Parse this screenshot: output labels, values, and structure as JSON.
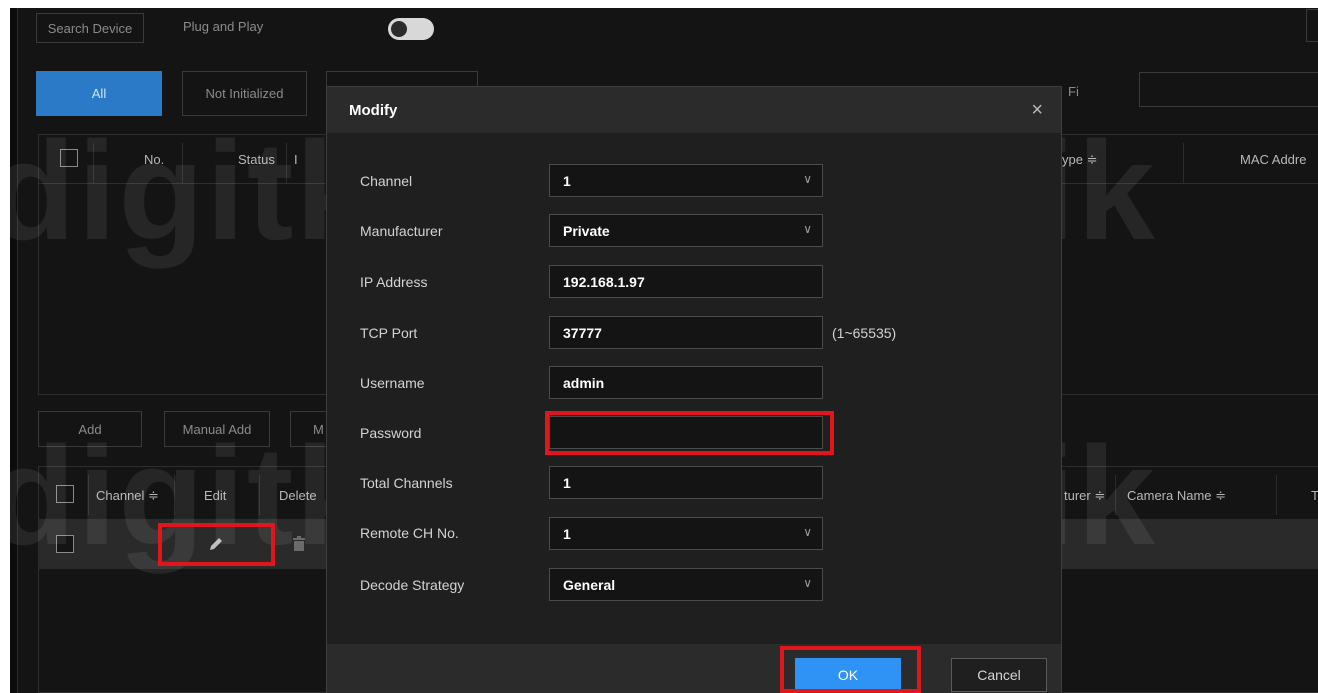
{
  "toolbar": {
    "search_device": "Search Device",
    "plug_and_play": "Plug and Play"
  },
  "filter_tabs": {
    "all": "All",
    "not_initialized": "Not Initialized",
    "filter_partial": "Fi"
  },
  "search_table": {
    "headers": {
      "no": "No.",
      "status": "Status",
      "ip_partial": "I",
      "type_partial": "ype ≑",
      "mac_partial": "MAC Addre"
    }
  },
  "actions": {
    "add": "Add",
    "manual_add": "Manual Add",
    "more_partial": "M"
  },
  "added_table": {
    "headers": {
      "channel": "Channel ≑",
      "edit": "Edit",
      "delete": "Delete",
      "manufacturer_partial": "turer ≑",
      "camera_name": "Camera Name ≑",
      "t_partial": "T"
    }
  },
  "watermark": "digitklik",
  "dialog": {
    "title": "Modify",
    "close_icon": "×",
    "fields": {
      "channel": {
        "label": "Channel",
        "value": "1"
      },
      "manufacturer": {
        "label": "Manufacturer",
        "value": "Private"
      },
      "ip_address": {
        "label": "IP Address",
        "value": "192.168.1.97"
      },
      "tcp_port": {
        "label": "TCP Port",
        "value": "37777",
        "hint": "(1~65535)"
      },
      "username": {
        "label": "Username",
        "value": "admin"
      },
      "password": {
        "label": "Password",
        "value": ""
      },
      "total_channels": {
        "label": "Total Channels",
        "value": "1"
      },
      "remote_ch_no": {
        "label": "Remote CH No.",
        "value": "1"
      },
      "decode_strategy": {
        "label": "Decode Strategy",
        "value": "General"
      }
    },
    "ok": "OK",
    "cancel": "Cancel"
  },
  "colors": {
    "accent": "#2f93f5",
    "highlight": "#e1151d",
    "tab_active": "#2a7ac8"
  }
}
